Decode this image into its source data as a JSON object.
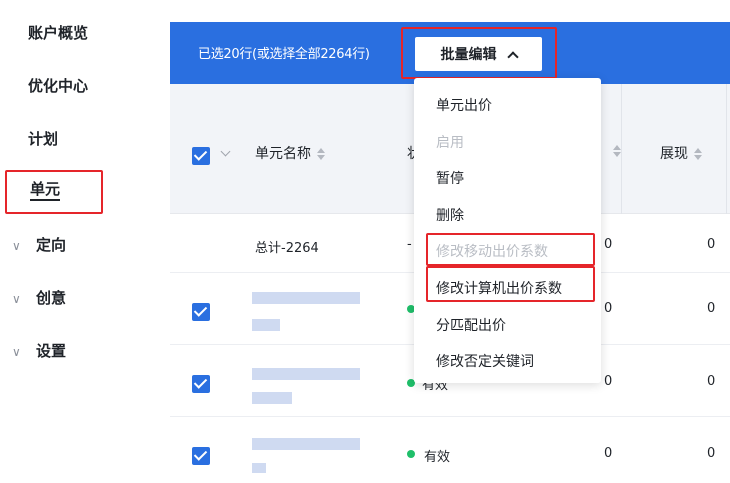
{
  "sidebar": {
    "items": [
      {
        "label": "账户概览",
        "expandable": false,
        "active": false
      },
      {
        "label": "优化中心",
        "expandable": false,
        "active": false
      },
      {
        "label": "计划",
        "expandable": false,
        "active": false
      },
      {
        "label": "单元",
        "expandable": false,
        "active": true
      },
      {
        "label": "定向",
        "expandable": true,
        "active": false
      },
      {
        "label": "创意",
        "expandable": true,
        "active": false
      },
      {
        "label": "设置",
        "expandable": true,
        "active": false
      }
    ]
  },
  "selection_bar": {
    "text": "已选20行(或选择全部2264行)",
    "batch_edit_label": "批量编辑"
  },
  "table": {
    "columns": [
      "单元名称",
      "状",
      "展现"
    ],
    "summary_row": {
      "name": "总计-2264",
      "status": "-",
      "value_a": "0",
      "value_b": "0"
    },
    "rows": [
      {
        "status": "有效",
        "value_a": "0",
        "value_b": "0"
      },
      {
        "status": "有效",
        "value_a": "0",
        "value_b": "0"
      },
      {
        "status": "有效",
        "value_a": "0",
        "value_b": "0"
      }
    ]
  },
  "dropdown": {
    "items": [
      {
        "label": "单元出价",
        "disabled": false
      },
      {
        "label": "启用",
        "disabled": true
      },
      {
        "label": "暂停",
        "disabled": false
      },
      {
        "label": "删除",
        "disabled": false
      },
      {
        "label": "修改移动出价系数",
        "disabled": true
      },
      {
        "label": "修改计算机出价系数",
        "disabled": false
      },
      {
        "label": "分匹配出价",
        "disabled": false
      },
      {
        "label": "修改否定关键词",
        "disabled": false
      }
    ]
  },
  "colors": {
    "primary": "#2a6fe0",
    "highlight_box": "#e5252a",
    "status_active": "#1fbf6a",
    "disabled_text": "#b9bdc4"
  }
}
